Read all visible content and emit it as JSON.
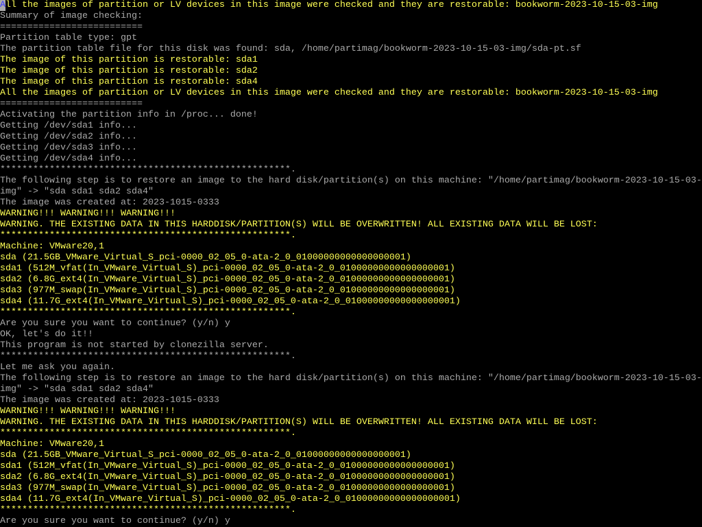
{
  "terminal": {
    "cursor_char": "A",
    "colors": {
      "background": "#000000",
      "normal": "#aaaaaa",
      "highlight": "#ffff55",
      "cursor_bg": "#aaaaaa",
      "cursor_fg": "#3a3aff"
    },
    "lines": [
      {
        "text": "ll the images of partition or LV devices in this image were checked and they are restorable: bookworm-2023-10-15-03-img",
        "color": "yellow",
        "has_cursor": true
      },
      {
        "text": "Summary of image checking:",
        "color": "gray"
      },
      {
        "text": "==========================",
        "color": "gray"
      },
      {
        "text": "Partition table type: gpt",
        "color": "gray"
      },
      {
        "text": "The partition table file for this disk was found: sda, /home/partimag/bookworm-2023-10-15-03-img/sda-pt.sf",
        "color": "gray"
      },
      {
        "text": "The image of this partition is restorable: sda1",
        "color": "yellow"
      },
      {
        "text": "The image of this partition is restorable: sda2",
        "color": "yellow"
      },
      {
        "text": "The image of this partition is restorable: sda4",
        "color": "yellow"
      },
      {
        "text": "All the images of partition or LV devices in this image were checked and they are restorable: bookworm-2023-10-15-03-img",
        "color": "yellow"
      },
      {
        "text": "==========================",
        "color": "gray"
      },
      {
        "text": "Activating the partition info in /proc... done!",
        "color": "gray"
      },
      {
        "text": "Getting /dev/sda1 info...",
        "color": "gray"
      },
      {
        "text": "Getting /dev/sda2 info...",
        "color": "gray"
      },
      {
        "text": "Getting /dev/sda3 info...",
        "color": "gray"
      },
      {
        "text": "Getting /dev/sda4 info...",
        "color": "gray"
      },
      {
        "text": "*****************************************************.",
        "color": "gray"
      },
      {
        "text": "The following step is to restore an image to the hard disk/partition(s) on this machine: \"/home/partimag/bookworm-2023-10-15-03-",
        "color": "gray"
      },
      {
        "text": "img\" -> \"sda sda1 sda2 sda4\"",
        "color": "gray"
      },
      {
        "text": "The image was created at: 2023-1015-0333",
        "color": "gray"
      },
      {
        "text": "WARNING!!! WARNING!!! WARNING!!!",
        "color": "yellow"
      },
      {
        "text": "WARNING. THE EXISTING DATA IN THIS HARDDISK/PARTITION(S) WILL BE OVERWRITTEN! ALL EXISTING DATA WILL BE LOST:",
        "color": "yellow"
      },
      {
        "text": "*****************************************************.",
        "color": "yellow"
      },
      {
        "text": "Machine: VMware20,1",
        "color": "yellow"
      },
      {
        "text": "sda (21.5GB_VMware_Virtual_S_pci-0000_02_05_0-ata-2_0_01000000000000000001)",
        "color": "yellow"
      },
      {
        "text": "sda1 (512M_vfat(In_VMware_Virtual_S)_pci-0000_02_05_0-ata-2_0_01000000000000000001)",
        "color": "yellow"
      },
      {
        "text": "sda2 (6.8G_ext4(In_VMware_Virtual_S)_pci-0000_02_05_0-ata-2_0_01000000000000000001)",
        "color": "yellow"
      },
      {
        "text": "sda3 (977M_swap(In_VMware_Virtual_S)_pci-0000_02_05_0-ata-2_0_01000000000000000001)",
        "color": "yellow"
      },
      {
        "text": "sda4 (11.7G_ext4(In_VMware_Virtual_S)_pci-0000_02_05_0-ata-2_0_01000000000000000001)",
        "color": "yellow"
      },
      {
        "text": "*****************************************************.",
        "color": "yellow"
      },
      {
        "text": "Are you sure you want to continue? (y/n) y",
        "color": "gray"
      },
      {
        "text": "OK, let's do it!!",
        "color": "gray"
      },
      {
        "text": "This program is not started by clonezilla server.",
        "color": "gray"
      },
      {
        "text": "*****************************************************.",
        "color": "gray"
      },
      {
        "text": "Let me ask you again.",
        "color": "gray"
      },
      {
        "text": "The following step is to restore an image to the hard disk/partition(s) on this machine: \"/home/partimag/bookworm-2023-10-15-03-",
        "color": "gray"
      },
      {
        "text": "img\" -> \"sda sda1 sda2 sda4\"",
        "color": "gray"
      },
      {
        "text": "The image was created at: 2023-1015-0333",
        "color": "gray"
      },
      {
        "text": "WARNING!!! WARNING!!! WARNING!!!",
        "color": "yellow"
      },
      {
        "text": "WARNING. THE EXISTING DATA IN THIS HARDDISK/PARTITION(S) WILL BE OVERWRITTEN! ALL EXISTING DATA WILL BE LOST:",
        "color": "yellow"
      },
      {
        "text": "*****************************************************.",
        "color": "yellow"
      },
      {
        "text": "Machine: VMware20,1",
        "color": "yellow"
      },
      {
        "text": "sda (21.5GB_VMware_Virtual_S_pci-0000_02_05_0-ata-2_0_01000000000000000001)",
        "color": "yellow"
      },
      {
        "text": "sda1 (512M_vfat(In_VMware_Virtual_S)_pci-0000_02_05_0-ata-2_0_01000000000000000001)",
        "color": "yellow"
      },
      {
        "text": "sda2 (6.8G_ext4(In_VMware_Virtual_S)_pci-0000_02_05_0-ata-2_0_01000000000000000001)",
        "color": "yellow"
      },
      {
        "text": "sda3 (977M_swap(In_VMware_Virtual_S)_pci-0000_02_05_0-ata-2_0_01000000000000000001)",
        "color": "yellow"
      },
      {
        "text": "sda4 (11.7G_ext4(In_VMware_Virtual_S)_pci-0000_02_05_0-ata-2_0_01000000000000000001)",
        "color": "yellow"
      },
      {
        "text": "*****************************************************.",
        "color": "yellow"
      },
      {
        "text": "Are you sure you want to continue? (y/n) y",
        "color": "gray"
      }
    ]
  }
}
